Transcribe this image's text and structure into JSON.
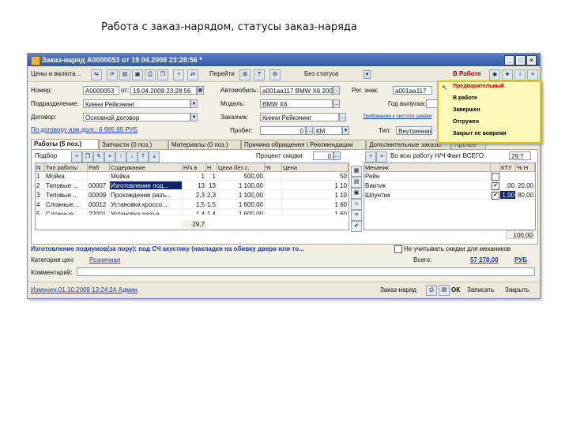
{
  "slide": {
    "title": "Работа с заказ-нарядом, статусы заказ-наряда"
  },
  "window": {
    "title": "Заказ-наряд А0000053 от 19.04.2008 23:28:56 *",
    "btn_min": "_",
    "btn_max": "□",
    "btn_close": "×"
  },
  "toolbar": {
    "prices": "Цены и валюта...",
    "arrow": "▾",
    "goto": "Перейти",
    "status_btn": "Без статуса",
    "status_top": "В Работе"
  },
  "form": {
    "number_label": "Номер:",
    "number_value": "А0000053",
    "from_label": "от:",
    "date_value": "19.04.2008 23:28:56",
    "car_label": "Автомобиль:",
    "car_value": "a001aa117 BMW X6 2008",
    "regnum_label": "Рег. знак:",
    "regnum_value": "a001aa117",
    "division_label": "Подразделение:",
    "division_value": "Кинни Рейкэнинг",
    "model_label": "Модель:",
    "model_value": "BMW X6",
    "tech_label": "Год выпуска:",
    "contract_label": "Договор:",
    "contract_value": "Основной договор",
    "customer_label": "Заказчик:",
    "customer_value": "Кинни Рейкэнинг",
    "link_requirements": "Требования к чистоте заявки",
    "contract_link": "По договору изм.долг.: 6 985,95 РУБ",
    "mileage_label": "Пробег:",
    "mileage_value": "0",
    "unit_value": "КМ",
    "type_label": "Тип:",
    "type_value": "Внутренний"
  },
  "tabs": [
    "Работы (5 поз.)",
    "Запчасти (0 поз.)",
    "Материалы (0 поз.)",
    "Причина обращения \\ Рекомендации",
    "Дополнительные заказы",
    "Прочее"
  ],
  "works": {
    "picker": "Подбор",
    "discount_label": "Процент скидки:",
    "discount_value": "0",
    "headers": [
      "N",
      "Тип работы",
      "Раб",
      "Содержание",
      "Н/ч в",
      "Н",
      "Цена без с.",
      "%",
      "Цена"
    ],
    "rows": [
      [
        "1",
        "Мойка",
        "",
        "Мойка",
        "1",
        "1",
        "500,00",
        "",
        "50"
      ],
      [
        "2",
        "Типовые ...",
        "00007",
        "Изготовление под...",
        "13",
        "13",
        "1 100,00",
        "",
        "1 10"
      ],
      [
        "3",
        "Типовые ...",
        "00009",
        "Прохождение разъ...",
        "2,3",
        "2,3",
        "1 100,00",
        "",
        "1 10"
      ],
      [
        "4",
        "Сложные...",
        "00012",
        "Установка кроссо...",
        "1,5",
        "1,5",
        "1 600,00",
        "",
        "1 60"
      ],
      [
        "5",
        "Сложные...",
        "22001",
        "Установка разъе...",
        "1,4",
        "1,4",
        "1 600,00",
        "",
        "1 60"
      ]
    ],
    "total": "29,7"
  },
  "mechanics": {
    "all_label": "Во всю работу Н/Ч Факт ВСЕГО:",
    "all_value": "29,7",
    "headers": [
      "Механик",
      "",
      "КТУ",
      "% Н"
    ],
    "rows": [
      {
        "name": "Рейн",
        "check": "",
        "ktu": "",
        "pct": ""
      },
      {
        "name": "Винтик",
        "check": "✔",
        "ktu": ",00",
        "pct": "20,00"
      },
      {
        "name": "Шпунтик",
        "check": "✔",
        "ktu": "1,00",
        "pct": "80,00"
      }
    ],
    "total": "100,00"
  },
  "bottom": {
    "work_name": "Изготовление подиумов(за пору): под СЧ акустику (накладки на обивку двери или то...",
    "ignore_label": "Не учитывать скидки для механиков",
    "price_category_label": "Категория цен:",
    "price_category_value": "Розничная",
    "total_label": "Всего:",
    "total_value": "57 278,00",
    "currency": "РУБ",
    "comment_label": "Комментарий:"
  },
  "status": {
    "changed": "Изменен:01.10.2008 13:24:24 Админ",
    "order": "Заказ-наряд",
    "ok": "ОК",
    "save": "Записать",
    "close": "Закрыть"
  },
  "status_menu": [
    "Предварительный",
    "В работе",
    "Завершен",
    "Отгружен",
    "Закрыт не вовремя"
  ],
  "colors": {
    "title_bar": "#2f58a8",
    "selection": "#0a246a",
    "popup_bg": "#fff8b8",
    "link": "#1a3fb0"
  }
}
